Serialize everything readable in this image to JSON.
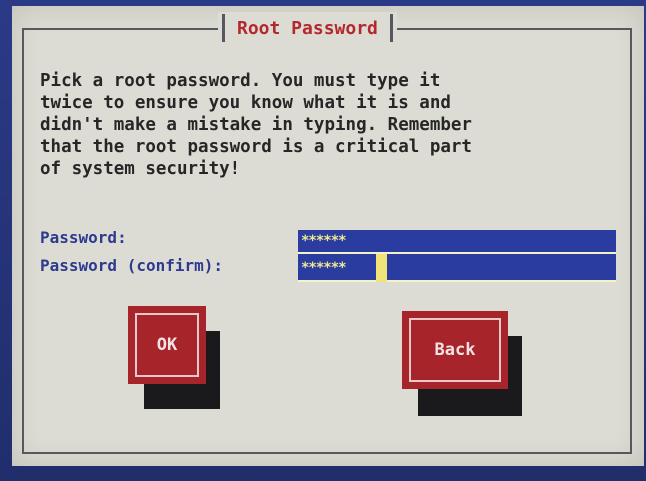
{
  "dialog": {
    "title": "Root Password",
    "message": "Pick a root password. You must type it\ntwice to ensure you know what it is and\ndidn't make a mistake in typing. Remember\nthat the root password is a critical part\nof system security!"
  },
  "fields": {
    "password": {
      "label": "Password:",
      "value": "******"
    },
    "confirm": {
      "label": "Password (confirm):",
      "value": "******"
    }
  },
  "buttons": {
    "ok": "OK",
    "back": "Back"
  },
  "colors": {
    "accent": "#b3282d",
    "field_bg": "#2b3ca0",
    "dialog_bg": "#dcdcd4",
    "button_bg": "#a8242b"
  }
}
